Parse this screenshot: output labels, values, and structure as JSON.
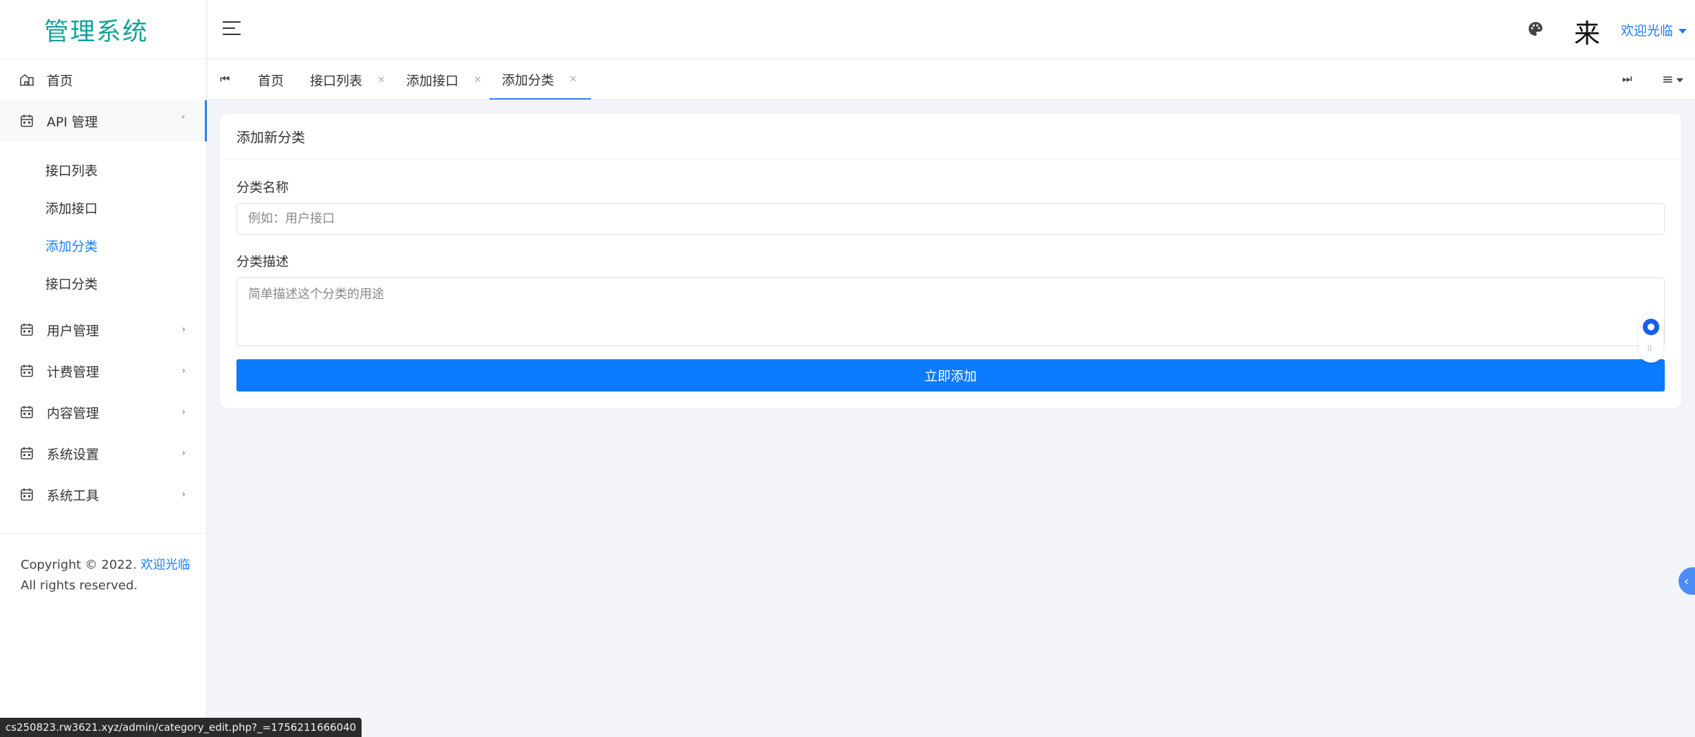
{
  "brand": {
    "title": "管理系统"
  },
  "sidebar": {
    "home": "首页",
    "api_group": "API 管理",
    "api_sub": [
      "接口列表",
      "添加接口",
      "添加分类",
      "接口分类"
    ],
    "groups": [
      "用户管理",
      "计费管理",
      "内容管理",
      "系统设置",
      "系统工具"
    ],
    "copyright_prefix": "Copyright © 2022.",
    "copyright_link": "欢迎光临",
    "copyright_suffix": "All rights reserved."
  },
  "header": {
    "avatar_glyph": "来",
    "user_menu": "欢迎光临"
  },
  "tabs": [
    {
      "label": "首页",
      "closable": false
    },
    {
      "label": "接口列表",
      "closable": true
    },
    {
      "label": "添加接口",
      "closable": true
    },
    {
      "label": "添加分类",
      "closable": true,
      "active": true
    }
  ],
  "tab_close_glyph": "×",
  "form": {
    "card_title": "添加新分类",
    "name_label": "分类名称",
    "name_placeholder": "例如：用户接口",
    "desc_label": "分类描述",
    "desc_placeholder": "简单描述这个分类的用途",
    "submit_label": "立即添加"
  },
  "status_url": "cs250823.rw3621.xyz/admin/category_edit.php?_=1756211666040",
  "colors": {
    "accent": "#0a7bff",
    "brand": "#14a39a"
  }
}
